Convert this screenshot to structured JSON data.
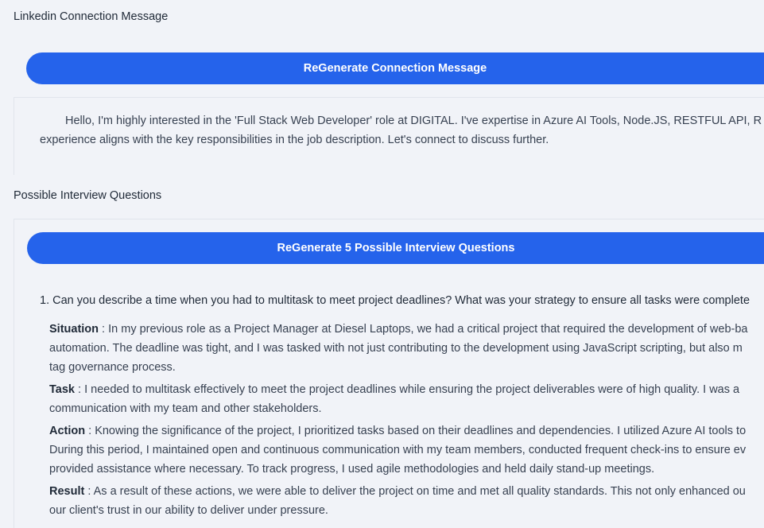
{
  "linkedin": {
    "section_title": "Linkedin Connection Message",
    "regen_button_label": "ReGenerate Connection Message",
    "message_line1": "Hello, I'm highly interested in the 'Full Stack Web Developer' role at DIGITAL. I've expertise in Azure AI Tools, Node.JS, RESTFUL API, R",
    "message_line2": "experience aligns with the key responsibilities in the job description. Let's connect to discuss further."
  },
  "interview": {
    "section_title": "Possible Interview Questions",
    "regen_button_label": "ReGenerate 5 Possible Interview Questions",
    "questions": [
      {
        "text": "1. Can you describe a time when you had to multitask to meet project deadlines? What was your strategy to ensure all tasks were complete",
        "situation_label": "Situation",
        "situation_lines": [
          " : In my previous role as a Project Manager at Diesel Laptops, we had a critical project that required the development of web-ba",
          "automation. The deadline was tight, and I was tasked with not just contributing to the development using JavaScript scripting, but also m",
          "tag governance process."
        ],
        "task_label": "Task",
        "task_lines": [
          " : I needed to multitask effectively to meet the project deadlines while ensuring the project deliverables were of high quality. I was a",
          "communication with my team and other stakeholders."
        ],
        "action_label": "Action",
        "action_lines": [
          " : Knowing the significance of the project, I prioritized tasks based on their deadlines and dependencies. I utilized Azure AI tools to",
          "During this period, I maintained open and continuous communication with my team members, conducted frequent check-ins to ensure ev",
          "provided assistance where necessary. To track progress, I used agile methodologies and held daily stand-up meetings."
        ],
        "result_label": "Result",
        "result_lines": [
          " : As a result of these actions, we were able to deliver the project on time and met all quality standards. This not only enhanced ou",
          "our client's trust in our ability to deliver under pressure."
        ]
      }
    ]
  },
  "colors": {
    "background": "#f1f3f8",
    "button": "#2563eb",
    "button_text": "#ffffff"
  }
}
